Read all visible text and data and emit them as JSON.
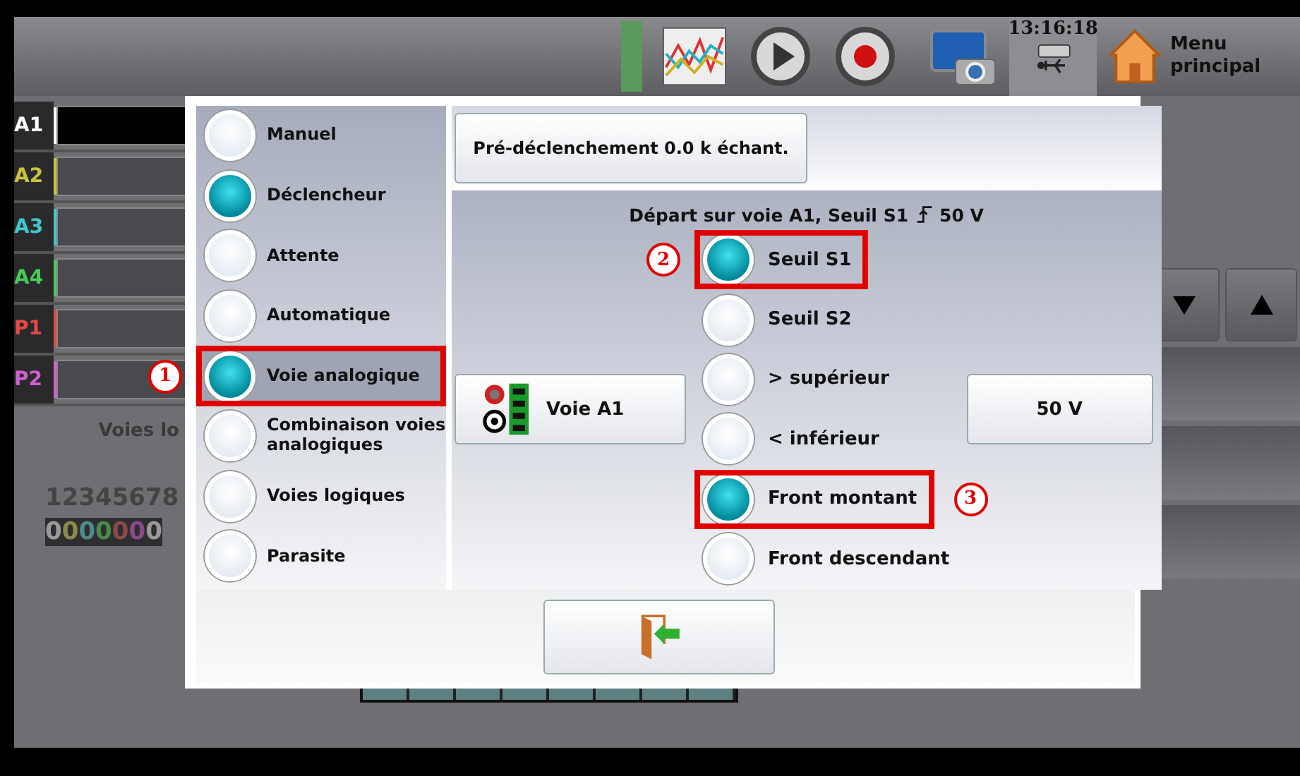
{
  "toolbar": {
    "time": "13:16:18",
    "home_label": "Menu principal"
  },
  "channels": [
    {
      "label": "A1",
      "color": "#ffffff"
    },
    {
      "label": "A2",
      "color": "#c8c43a"
    },
    {
      "label": "A3",
      "color": "#40c8cc"
    },
    {
      "label": "A4",
      "color": "#48cc58"
    },
    {
      "label": "P1",
      "color": "#e84848"
    },
    {
      "label": "P2",
      "color": "#d060d0"
    }
  ],
  "channels_caption": "Voies lo",
  "logic_numbers": "12345678",
  "logic_states": [
    {
      "text": "0"
    },
    {
      "text": "0",
      "color": "#8a8a4a"
    },
    {
      "text": "0",
      "color": "#4a8a8a"
    },
    {
      "text": "0",
      "color": "#4a8a4a"
    },
    {
      "text": "0",
      "color": "#8a4a4a"
    },
    {
      "text": "0",
      "color": "#8a4a8a"
    },
    {
      "text": "0"
    }
  ],
  "dialog": {
    "modes": [
      {
        "label": "Manuel",
        "selected": false
      },
      {
        "label": "Déclencheur",
        "selected": true
      },
      {
        "label": "Attente",
        "selected": false
      },
      {
        "label": "Automatique",
        "selected": false
      },
      {
        "label": "Voie analogique",
        "selected": true,
        "callout": "1"
      },
      {
        "label": "Combinaison voies analogiques",
        "selected": false
      },
      {
        "label": "Voies logiques",
        "selected": false
      },
      {
        "label": "Parasite",
        "selected": false
      }
    ],
    "pretrigger_button": "Pré-déclenchement 0.0 k échant.",
    "summary": "Départ sur voie A1, Seuil S1",
    "summary_value": "50 V",
    "channel_button": "Voie A1",
    "conditions": [
      {
        "label": "Seuil S1",
        "selected": true,
        "callout": "2"
      },
      {
        "label": "Seuil S2",
        "selected": false
      },
      {
        "label": "> supérieur",
        "selected": false
      },
      {
        "label": "< inférieur",
        "selected": false
      },
      {
        "label": "Front montant",
        "selected": true,
        "callout": "3"
      },
      {
        "label": "Front descendant",
        "selected": false
      }
    ],
    "level_button": "50 V"
  }
}
